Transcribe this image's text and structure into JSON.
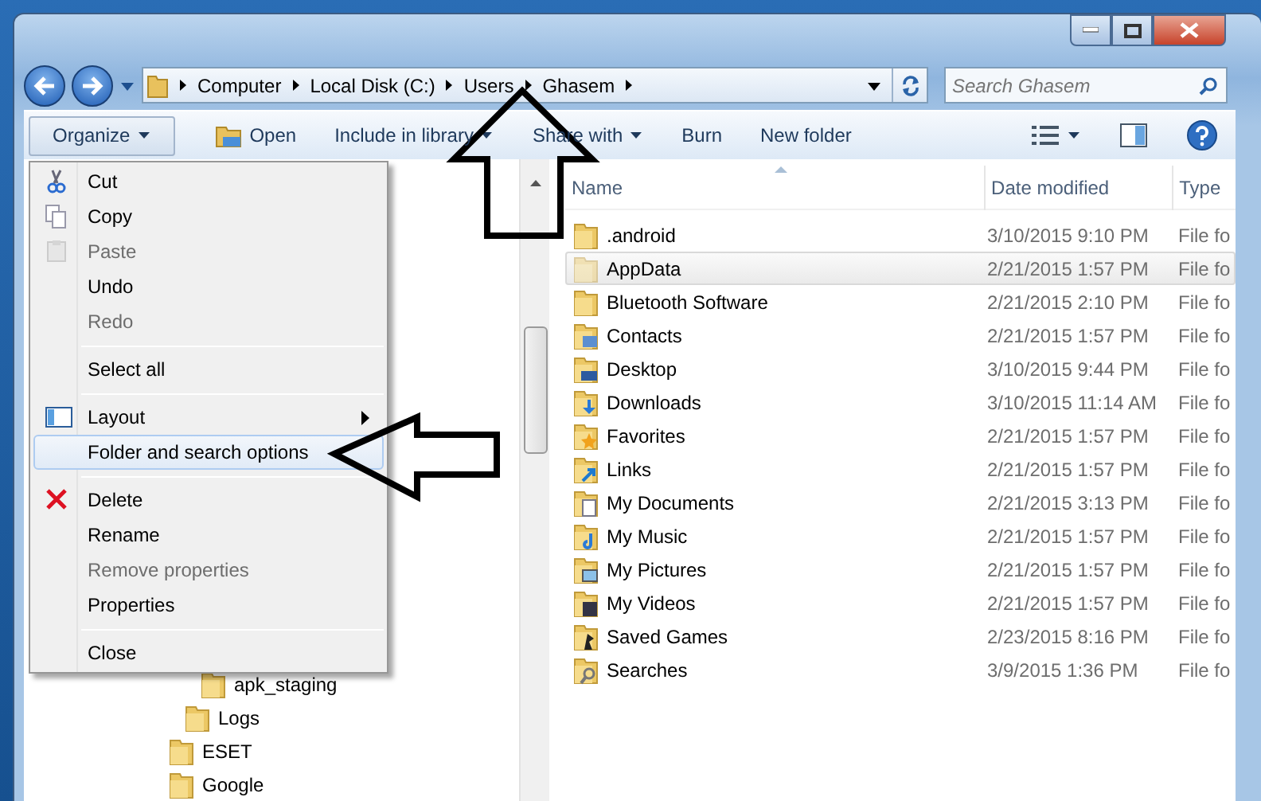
{
  "address_bar": {
    "crumbs": [
      "Computer",
      "Local Disk (C:)",
      "Users",
      "Ghasem"
    ]
  },
  "search": {
    "placeholder": "Search Ghasem"
  },
  "toolbar": {
    "items": [
      {
        "label": "Organize",
        "kind": "dropdown",
        "selected": true
      },
      {
        "label": "Open",
        "kind": "icon-button",
        "selected": false
      },
      {
        "label": "Include in library",
        "kind": "dropdown",
        "selected": false
      },
      {
        "label": "Share with",
        "kind": "dropdown",
        "selected": false
      },
      {
        "label": "Burn",
        "kind": "plain",
        "selected": false
      },
      {
        "label": "New folder",
        "kind": "plain",
        "selected": false
      }
    ]
  },
  "nav_tree": [
    {
      "children": [
        {
          "children": [
            {
              "label": "apk_staging"
            }
          ]
        },
        {
          "label": "Logs"
        }
      ]
    },
    {
      "label": "ESET"
    },
    {
      "label": "Google"
    }
  ],
  "file_list": {
    "columns": [
      {
        "label": "Name",
        "sorted": true
      },
      {
        "label": "Date modified",
        "sorted": false
      },
      {
        "label": "Type",
        "sorted": false
      }
    ],
    "rows": [
      {
        "name": ".android",
        "date": "3/10/2015 9:10 PM",
        "type": "File fo",
        "selected": false,
        "hidden": false
      },
      {
        "name": "AppData",
        "date": "2/21/2015 1:57 PM",
        "type": "File fo",
        "selected": true,
        "hidden": true
      },
      {
        "name": "Bluetooth Software",
        "date": "2/21/2015 2:10 PM",
        "type": "File fo",
        "selected": false,
        "hidden": false
      },
      {
        "name": "Contacts",
        "date": "2/21/2015 1:57 PM",
        "type": "File fo",
        "selected": false,
        "hidden": false
      },
      {
        "name": "Desktop",
        "date": "3/10/2015 9:44 PM",
        "type": "File fo",
        "selected": false,
        "hidden": false
      },
      {
        "name": "Downloads",
        "date": "3/10/2015 11:14 AM",
        "type": "File fo",
        "selected": false,
        "hidden": false
      },
      {
        "name": "Favorites",
        "date": "2/21/2015 1:57 PM",
        "type": "File fo",
        "selected": false,
        "hidden": false
      },
      {
        "name": "Links",
        "date": "2/21/2015 1:57 PM",
        "type": "File fo",
        "selected": false,
        "hidden": false
      },
      {
        "name": "My Documents",
        "date": "2/21/2015 3:13 PM",
        "type": "File fo",
        "selected": false,
        "hidden": false
      },
      {
        "name": "My Music",
        "date": "2/21/2015 1:57 PM",
        "type": "File fo",
        "selected": false,
        "hidden": false
      },
      {
        "name": "My Pictures",
        "date": "2/21/2015 1:57 PM",
        "type": "File fo",
        "selected": false,
        "hidden": false
      },
      {
        "name": "My Videos",
        "date": "2/21/2015 1:57 PM",
        "type": "File fo",
        "selected": false,
        "hidden": false
      },
      {
        "name": "Saved Games",
        "date": "2/23/2015 8:16 PM",
        "type": "File fo",
        "selected": false,
        "hidden": false
      },
      {
        "name": "Searches",
        "date": "3/9/2015 1:36 PM",
        "type": "File fo",
        "selected": false,
        "hidden": false
      }
    ]
  },
  "organize_menu": {
    "items": [
      {
        "kind": "item",
        "label": "Cut",
        "disabled": false,
        "selected": false
      },
      {
        "kind": "item",
        "label": "Copy",
        "disabled": false,
        "selected": false
      },
      {
        "kind": "item",
        "label": "Paste",
        "disabled": true,
        "selected": false
      },
      {
        "kind": "item",
        "label": "Undo",
        "disabled": false,
        "selected": false
      },
      {
        "kind": "item",
        "label": "Redo",
        "disabled": true,
        "selected": false
      },
      {
        "kind": "separator"
      },
      {
        "kind": "item",
        "label": "Select all",
        "disabled": false,
        "selected": false
      },
      {
        "kind": "separator"
      },
      {
        "kind": "submenu",
        "label": "Layout",
        "disabled": false,
        "selected": false
      },
      {
        "kind": "item",
        "label": "Folder and search options",
        "disabled": false,
        "selected": true
      },
      {
        "kind": "separator"
      },
      {
        "kind": "item",
        "label": "Delete",
        "disabled": false,
        "selected": false
      },
      {
        "kind": "item",
        "label": "Rename",
        "disabled": false,
        "selected": false
      },
      {
        "kind": "item",
        "label": "Remove properties",
        "disabled": true,
        "selected": false
      },
      {
        "kind": "item",
        "label": "Properties",
        "disabled": false,
        "selected": false
      },
      {
        "kind": "separator"
      },
      {
        "kind": "item",
        "label": "Close",
        "disabled": false,
        "selected": false
      }
    ]
  }
}
